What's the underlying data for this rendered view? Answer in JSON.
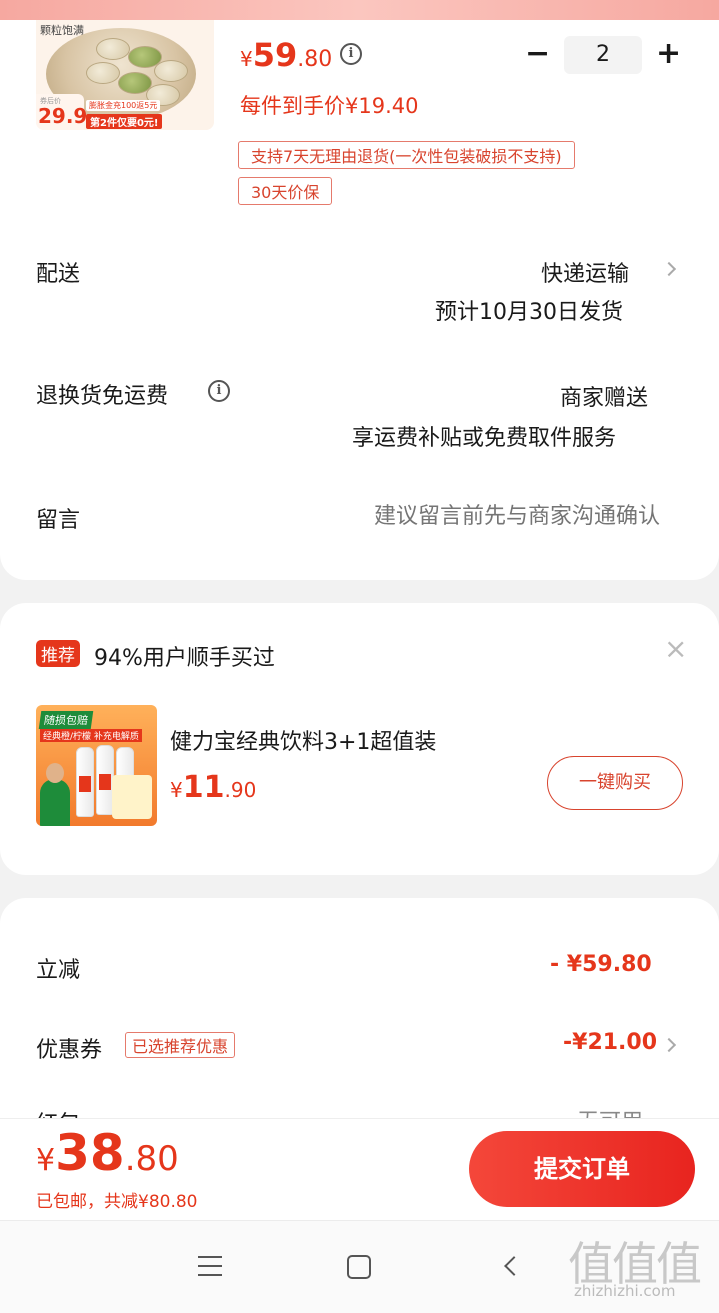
{
  "product": {
    "thumb_tag": "颗粒饱满",
    "thumb_price_label": "券后价",
    "thumb_price": "29.9",
    "thumb_promo_1": "膨胀金充100返5元",
    "thumb_promo_2": "第2件仅要0元!",
    "price_symbol": "¥",
    "price_int": "59",
    "price_dec": ".80",
    "unit_price_label": "每件到手价¥19.40",
    "quantity": "2",
    "minus": "−",
    "plus": "+",
    "tags": [
      "支持7天无理由退货(一次性包装破损不支持)",
      "30天价保"
    ]
  },
  "delivery": {
    "label": "配送",
    "method": "快递运输",
    "estimate": "预计10月30日发货"
  },
  "return_shipping": {
    "label": "退换货免运费",
    "value": "商家赠送",
    "desc": "享运费补贴或免费取件服务"
  },
  "message": {
    "label": "留言",
    "placeholder": "建议留言前先与商家沟通确认"
  },
  "recommend": {
    "badge": "推荐",
    "title": "94%用户顺手买过",
    "close": "×",
    "item_name": "健力宝经典饮料3+1超值装",
    "price_symbol": "¥",
    "price_int": "11",
    "price_dec": ".90",
    "thumb_banner": "随损包赔",
    "thumb_sub": "经典橙/柠檬 补充电解质",
    "buy_label": "一键购买"
  },
  "discounts": {
    "instant_label": "立减",
    "instant_value": "- ¥59.80",
    "coupon_label": "优惠券",
    "coupon_tag": "已选推荐优惠",
    "coupon_value": "-¥21.00",
    "redpacket_label": "红包",
    "redpacket_value": "无可用"
  },
  "footer": {
    "total_symbol": "¥",
    "total_int": "38",
    "total_dec": ".80",
    "shipping_note": "已包邮，共减¥80.80",
    "submit_label": "提交订单"
  },
  "watermark": {
    "chars": "值值值",
    "domain": "zhizhizhi.com"
  },
  "colors": {
    "accent": "#e5361b",
    "submit": "#ee2d26"
  }
}
